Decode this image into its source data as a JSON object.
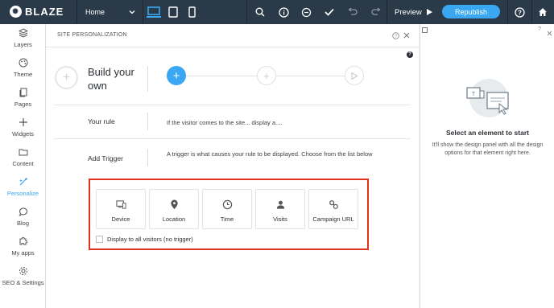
{
  "topbar": {
    "logo": "BLAZE",
    "page_select": "Home",
    "preview_label": "Preview",
    "republish_label": "Republish"
  },
  "sidebar": {
    "items": [
      {
        "label": "Layers",
        "icon": "layers-icon"
      },
      {
        "label": "Theme",
        "icon": "palette-icon"
      },
      {
        "label": "Pages",
        "icon": "pages-icon"
      },
      {
        "label": "Widgets",
        "icon": "plus-icon"
      },
      {
        "label": "Content",
        "icon": "folder-icon"
      },
      {
        "label": "Personalize",
        "icon": "personalize-icon"
      },
      {
        "label": "Blog",
        "icon": "chat-icon"
      },
      {
        "label": "My apps",
        "icon": "puzzle-icon"
      },
      {
        "label": "SEO & Settings",
        "icon": "gear-icon"
      }
    ],
    "active": "Personalize"
  },
  "panel": {
    "title": "SITE PERSONALIZATION",
    "build_title": "Build your own",
    "rule_label": "Your rule",
    "rule_text": "If the visitor comes to the site... display a....",
    "trigger_label": "Add Trigger",
    "trigger_text": "A trigger is what causes your rule to be displayed. Choose from the list below",
    "triggers": [
      "Device",
      "Location",
      "Time",
      "Visits",
      "Campaign URL"
    ],
    "no_trigger_label": "Display to all visitors (no trigger)",
    "accent_color": "#3aa7f3",
    "highlight_color": "#e1321f"
  },
  "right_panel": {
    "title": "Select an element to start",
    "text": "It'll show the design panel with all the design options for that element right here."
  }
}
